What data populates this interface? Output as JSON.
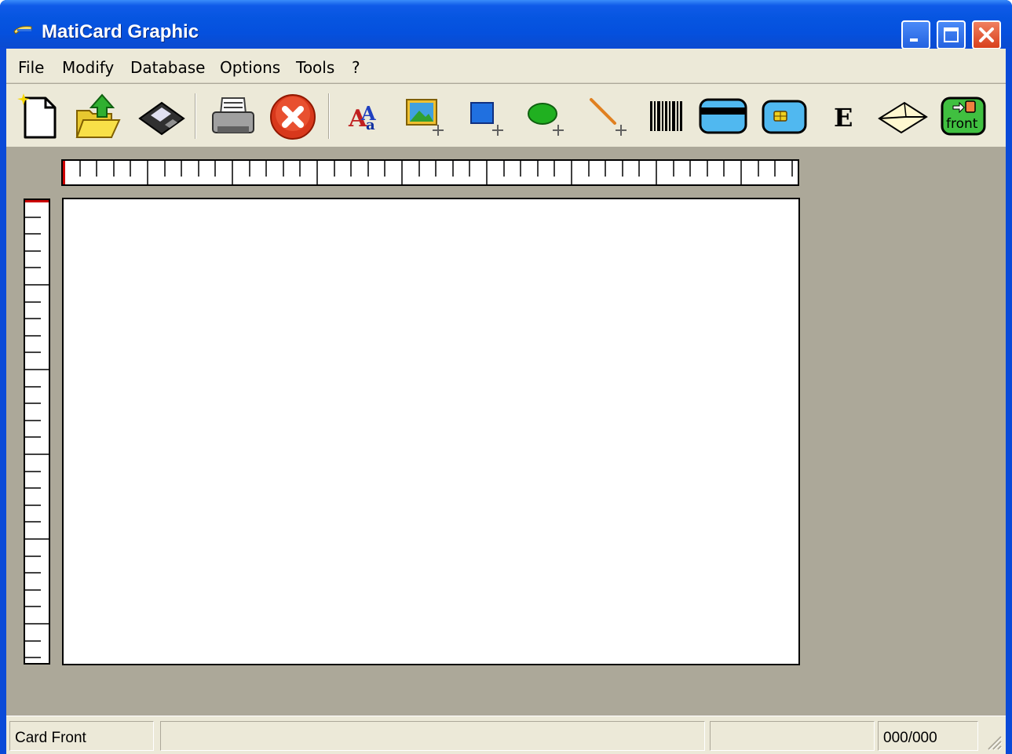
{
  "window": {
    "title": "MatiCard Graphic",
    "app_icon": "card-app-icon",
    "controls": [
      "minimize-icon",
      "maximize-icon",
      "close-icon"
    ]
  },
  "menu": {
    "items": [
      {
        "label": "File"
      },
      {
        "label": "Modify"
      },
      {
        "label": "Database"
      },
      {
        "label": "Options"
      },
      {
        "label": "Tools"
      },
      {
        "label": "?"
      }
    ]
  },
  "toolbar": {
    "buttons": [
      {
        "icon": "new-document-icon"
      },
      {
        "icon": "open-folder-icon"
      },
      {
        "icon": "save-disk-icon"
      },
      {
        "icon": "printer-icon"
      },
      {
        "icon": "cancel-icon"
      },
      {
        "icon": "text-tool-icon"
      },
      {
        "icon": "image-tool-icon"
      },
      {
        "icon": "rectangle-tool-icon"
      },
      {
        "icon": "ellipse-tool-icon"
      },
      {
        "icon": "line-tool-icon"
      },
      {
        "icon": "barcode-icon"
      },
      {
        "icon": "magnetic-stripe-icon"
      },
      {
        "icon": "chip-card-icon"
      },
      {
        "icon": "encode-icon",
        "label": "E"
      },
      {
        "icon": "envelope-icon"
      },
      {
        "icon": "card-side-icon",
        "label": "front"
      }
    ]
  },
  "colors": {
    "titlebar": "#0655e0",
    "workspace": "#aca899",
    "chrome": "#ece9d8",
    "ruler_marker": "#cc0000"
  },
  "statusbar": {
    "side": "Card Front",
    "panel2": "",
    "panel3": "",
    "counter": "000/000"
  }
}
